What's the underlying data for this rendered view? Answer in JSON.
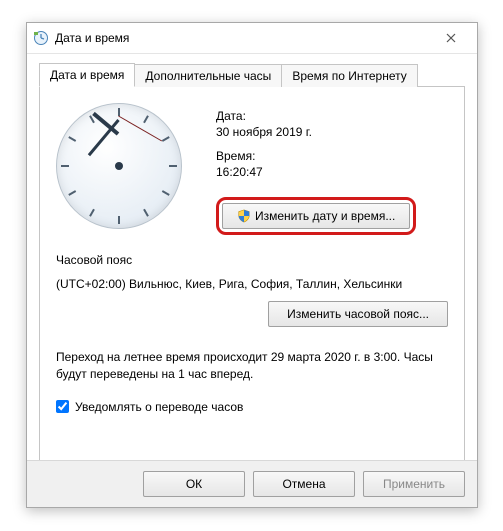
{
  "window": {
    "title": "Дата и время"
  },
  "tabs": {
    "t0": "Дата и время",
    "t1": "Дополнительные часы",
    "t2": "Время по Интернету"
  },
  "date": {
    "label": "Дата:",
    "value": "30 ноября 2019 г."
  },
  "time": {
    "label": "Время:",
    "value": "16:20:47"
  },
  "change_dt_btn": "Изменить дату и время...",
  "timezone": {
    "label": "Часовой пояс",
    "value": "(UTC+02:00) Вильнюс, Киев, Рига, София, Таллин, Хельсинки",
    "change_btn": "Изменить часовой пояс..."
  },
  "dst_text": "Переход на летнее время происходит 29 марта 2020 г. в 3:00. Часы будут переведены на 1 час вперед.",
  "notify_checkbox": "Уведомлять о переводе часов",
  "footer": {
    "ok": "ОК",
    "cancel": "Отмена",
    "apply": "Применить"
  }
}
